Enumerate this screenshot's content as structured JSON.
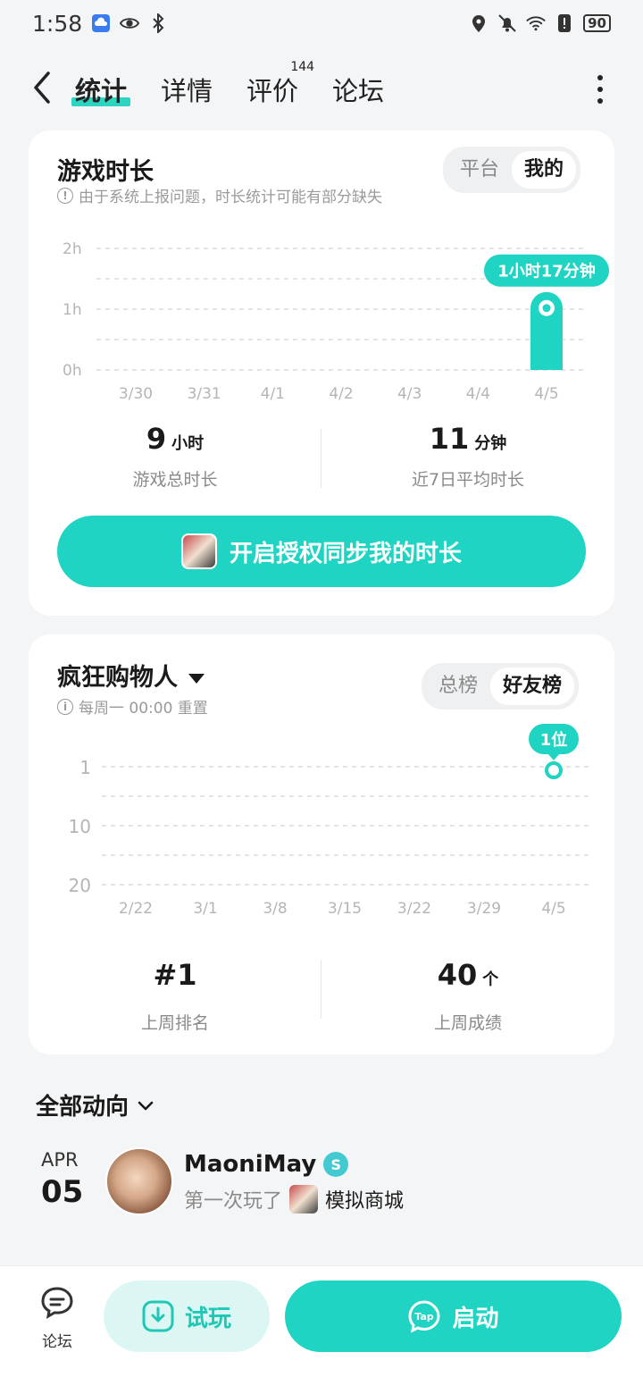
{
  "status_bar": {
    "time": "1:58",
    "battery": "90"
  },
  "header": {
    "tabs": [
      {
        "label": "统计",
        "badge": ""
      },
      {
        "label": "详情",
        "badge": ""
      },
      {
        "label": "评价",
        "badge": "144"
      },
      {
        "label": "论坛",
        "badge": ""
      }
    ]
  },
  "playtime": {
    "title": "游戏时长",
    "note": "由于系统上报问题，时长统计可能有部分缺失",
    "segment": [
      "平台",
      "我的"
    ],
    "stats": [
      {
        "value": "9",
        "unit": "小时",
        "label": "游戏总时长"
      },
      {
        "value": "11",
        "unit": "分钟",
        "label": "近7日平均时长"
      }
    ],
    "auth_button": "开启授权同步我的时长"
  },
  "leaderboard": {
    "title": "疯狂购物人",
    "note": "每周一 00:00 重置",
    "segment": [
      "总榜",
      "好友榜"
    ],
    "stats": [
      {
        "value": "#1",
        "unit": "",
        "label": "上周排名"
      },
      {
        "value": "40",
        "unit": "个",
        "label": "上周成绩"
      }
    ]
  },
  "chart_data": [
    {
      "type": "bar",
      "categories": [
        "3/30",
        "3/31",
        "4/1",
        "4/2",
        "4/3",
        "4/4",
        "4/5"
      ],
      "values": [
        0,
        0,
        0,
        0,
        0,
        0,
        1.2833
      ],
      "yticks": [
        "2h",
        "1h",
        "0h"
      ],
      "ylim": [
        0,
        2
      ],
      "highlight_label": "1小时17分钟",
      "color": "#1fd4c2"
    },
    {
      "type": "line",
      "categories": [
        "2/22",
        "3/1",
        "3/8",
        "3/15",
        "3/22",
        "3/29",
        "4/5"
      ],
      "values": [
        null,
        null,
        null,
        null,
        null,
        null,
        1
      ],
      "yticks": [
        "1",
        "10",
        "20"
      ],
      "highlight_label": "1位",
      "color": "#1fd4c2"
    }
  ],
  "feed": {
    "title": "全部动向",
    "items": [
      {
        "month": "APR",
        "day": "05",
        "user": "MaoniMay",
        "action": "第一次玩了",
        "game": "模拟商城"
      }
    ]
  },
  "bottom_bar": {
    "forum_label": "论坛",
    "try_label": "试玩",
    "launch_label": "启动"
  }
}
